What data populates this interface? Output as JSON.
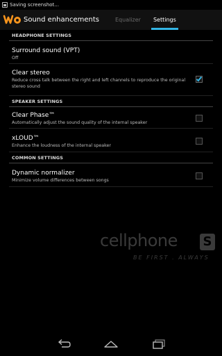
{
  "status_bar": {
    "text": "Saving screenshot..."
  },
  "action_bar": {
    "title": "Sound enhancements",
    "tabs": [
      {
        "label": "Equalizer",
        "active": false
      },
      {
        "label": "Settings",
        "active": true
      }
    ]
  },
  "sections": {
    "headphone": {
      "header": "HEADPHONE SETTINGS",
      "surround": {
        "title": "Surround sound (VPT)",
        "summary": "Off"
      },
      "clear_stereo": {
        "title": "Clear stereo",
        "summary": "Reduce cross talk between the right and left channels to reproduce the original stereo sound",
        "checked": true
      }
    },
    "speaker": {
      "header": "SPEAKER SETTINGS",
      "clear_phase": {
        "title": "Clear Phase™",
        "summary": "Automatically adjust the sound quality of the internal speaker",
        "checked": false
      },
      "xloud": {
        "title": "xLOUD™",
        "summary": "Enhance the loudness of the internal speaker",
        "checked": false
      }
    },
    "common": {
      "header": "COMMON SETTINGS",
      "dynamic_normalizer": {
        "title": "Dynamic normalizer",
        "summary": "Minimize volume differences between songs",
        "checked": false
      }
    }
  },
  "watermark": {
    "brand": "cellphone",
    "logo_letter": "S",
    "tagline": "BE FIRST . ALWAYS"
  },
  "colors": {
    "accent": "#33b5e5",
    "logo_orange": "#f7941d"
  }
}
